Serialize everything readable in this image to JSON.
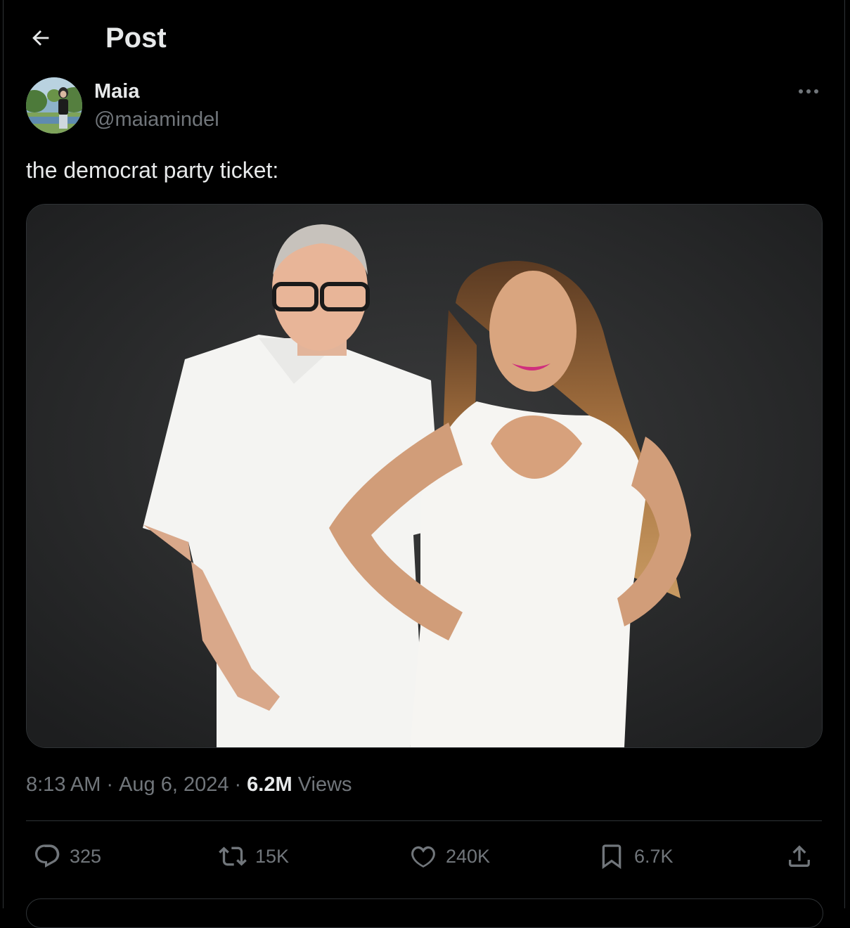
{
  "header": {
    "title": "Post",
    "back_icon": "arrow-left-icon"
  },
  "post": {
    "author_name": "Maia",
    "author_handle": "@maiamindel",
    "text": "the democrat party ticket:",
    "time": "8:13 AM",
    "date": "Aug 6, 2024",
    "views_count": "6.2M",
    "views_label": "Views",
    "separator": "·"
  },
  "actions": {
    "replies": "325",
    "reposts": "15K",
    "likes": "240K",
    "bookmarks": "6.7K"
  },
  "colors": {
    "background": "#000000",
    "text_primary": "#e7e9ea",
    "text_secondary": "#71767b",
    "divider": "#2f3336"
  }
}
